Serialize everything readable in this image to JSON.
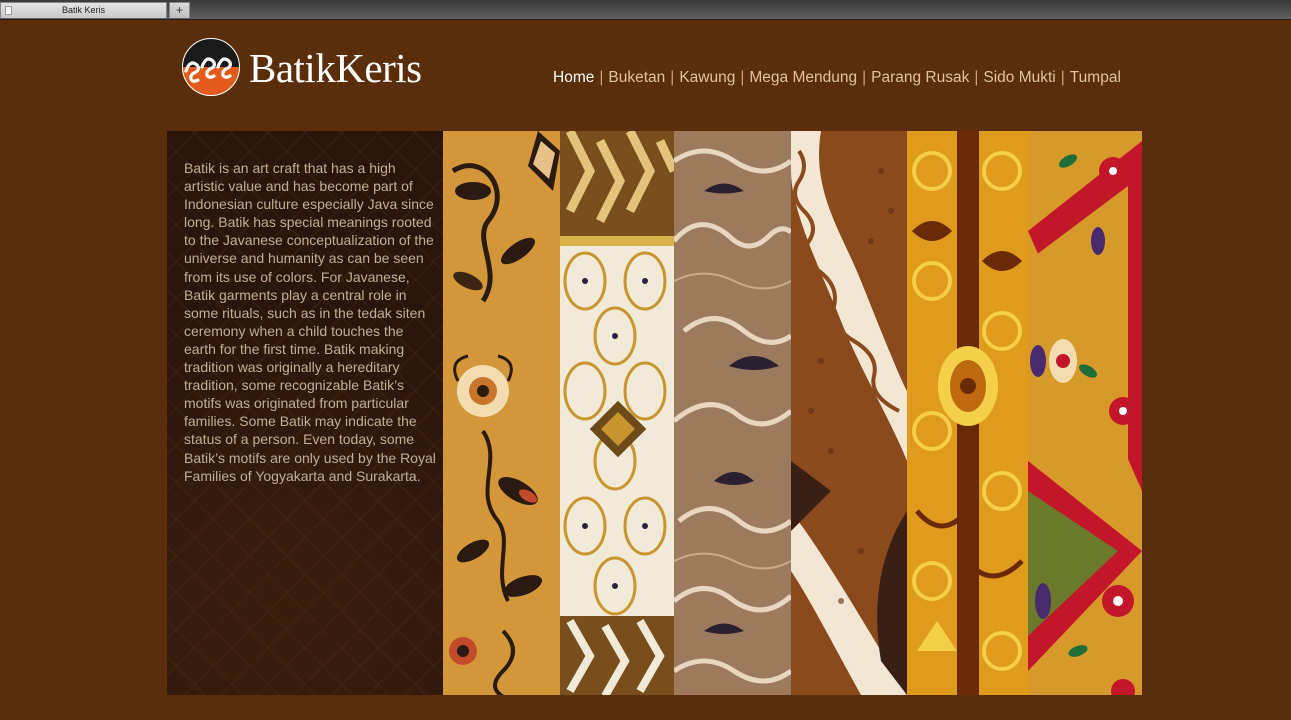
{
  "browser": {
    "tab_title": "Batik Keris",
    "new_tab_label": "+"
  },
  "site": {
    "brand": "BatikKeris"
  },
  "nav": {
    "items": [
      {
        "label": "Home",
        "active": true
      },
      {
        "label": "Buketan",
        "active": false
      },
      {
        "label": "Kawung",
        "active": false
      },
      {
        "label": "Mega Mendung",
        "active": false
      },
      {
        "label": "Parang Rusak",
        "active": false
      },
      {
        "label": "Sido Mukti",
        "active": false
      },
      {
        "label": "Tumpal",
        "active": false
      }
    ],
    "separator": "|"
  },
  "intro": {
    "text": "Batik is an art craft that has a high artistic value and has become part of Indonesian culture especially Java since long. Batik has special meanings rooted to the Javanese conceptualization of the universe and humanity as can be seen from its use of colors. For Javanese, Batik garments play a central role in some rituals, such as in the tedak siten ceremony when a child touches the earth for the first time. Batik making tradition was originally a hereditary tradition, some recognizable Batik’s motifs was originated from particular families. Some Batik may indicate the status of a person. Even today, some Batik’s motifs are only used by the Royal Families of Yogyakarta and Surakarta."
  },
  "strips": [
    {
      "name": "buketan-pattern-image",
      "colors": [
        "#d49a3a",
        "#2a1a10",
        "#f2dcb0"
      ]
    },
    {
      "name": "kawung-pattern-image",
      "colors": [
        "#f2ead8",
        "#6e4a1a",
        "#c8952e"
      ]
    },
    {
      "name": "mega-mendung-pattern-image",
      "colors": [
        "#9b7a5e",
        "#e8d6c0",
        "#2b2030"
      ]
    },
    {
      "name": "parang-rusak-pattern-image",
      "colors": [
        "#8a4a1c",
        "#f3e6d2",
        "#3a1f14"
      ]
    },
    {
      "name": "sido-mukti-pattern-image",
      "colors": [
        "#e09a1c",
        "#6b2a06",
        "#f4cf4a"
      ]
    },
    {
      "name": "tumpal-pattern-image",
      "colors": [
        "#d79a2a",
        "#c4162b",
        "#4a2a6e"
      ]
    }
  ],
  "colors": {
    "page_background": "#5a2e0a",
    "nav_text": "#e2c39c",
    "nav_active": "#ffffff",
    "intro_text": "#c5ad94",
    "logo_orange": "#e25b1c"
  }
}
